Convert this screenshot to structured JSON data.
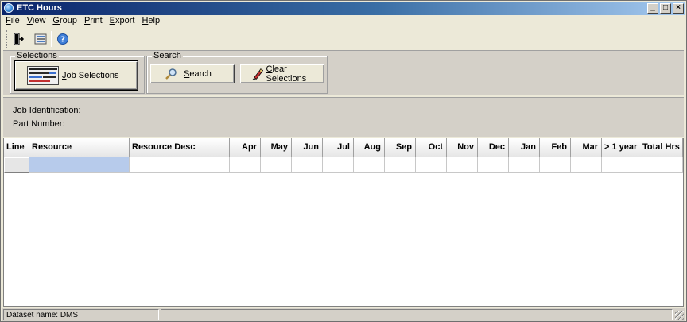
{
  "window": {
    "title": "ETC Hours",
    "buttons": [
      "_",
      "□",
      "×"
    ]
  },
  "menu": [
    {
      "label_ul": "F",
      "label_rest": "ile"
    },
    {
      "label_ul": "V",
      "label_rest": "iew"
    },
    {
      "label_ul": "G",
      "label_rest": "roup"
    },
    {
      "label_ul": "P",
      "label_rest": "rint"
    },
    {
      "label_ul": "E",
      "label_rest": "xport"
    },
    {
      "label_ul": "H",
      "label_rest": "elp"
    }
  ],
  "toolbar": {
    "icons": [
      "exit-icon",
      "layout-icon",
      "help-icon"
    ]
  },
  "selections": {
    "group_label": "Selections",
    "job_button_ul": "J",
    "job_button_rest": "ob Selections"
  },
  "search": {
    "group_label": "Search",
    "search_button_ul": "S",
    "search_button_rest": "earch",
    "clear_button_ul": "C",
    "clear_button_rest": "lear Selections"
  },
  "info": {
    "job_identification_label": "Job Identification:",
    "part_number_label": "Part Number:"
  },
  "grid": {
    "columns": [
      "Line",
      "Resource",
      "Resource Desc",
      "Apr",
      "May",
      "Jun",
      "Jul",
      "Aug",
      "Sep",
      "Oct",
      "Nov",
      "Dec",
      "Jan",
      "Feb",
      "Mar",
      "> 1 year",
      "Total Hrs"
    ],
    "rows": [
      [
        "",
        "",
        "",
        "",
        "",
        "",
        "",
        "",
        "",
        "",
        "",
        "",
        "",
        "",
        "",
        "",
        ""
      ]
    ]
  },
  "status": {
    "dataset_label": "Dataset name:",
    "dataset_value": "DMS"
  }
}
